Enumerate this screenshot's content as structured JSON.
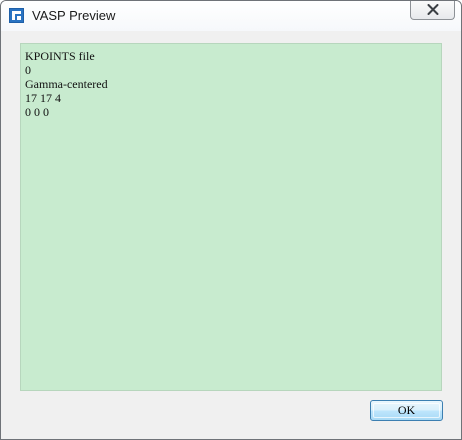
{
  "window": {
    "title": "VASP Preview"
  },
  "preview": {
    "lines": [
      "KPOINTS file",
      "0",
      "Gamma-centered",
      "17 17 4",
      "0 0 0"
    ],
    "background_color": "#c8ebcf"
  },
  "buttons": {
    "ok_label": "OK"
  },
  "icons": {
    "app": "app-logo-icon",
    "close": "close-icon"
  }
}
